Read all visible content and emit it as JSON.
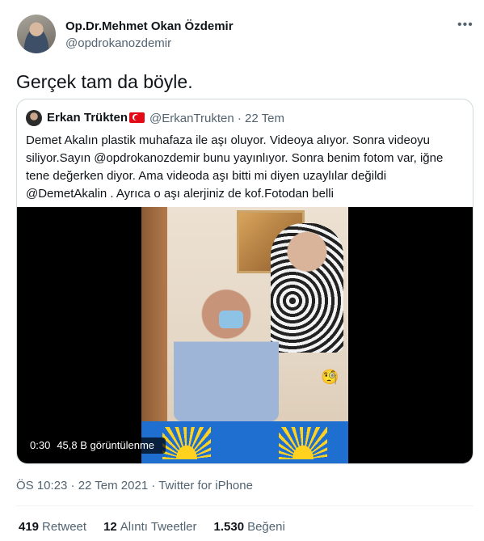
{
  "author": {
    "name": "Op.Dr.Mehmet Okan Özdemir",
    "handle": "@opdrokanozdemir"
  },
  "more_icon": "more-horizontal-icon",
  "tweet_text": "Gerçek tam da böyle.",
  "quote": {
    "author_name": "Erkan Trükten",
    "flag_icon": "turkey-flag-icon",
    "meta": "@ErkanTrukten · 22 Tem",
    "text": "Demet Akalın plastik muhafaza ile aşı oluyor. Videoya alıyor. Sonra videoyu siliyor.Sayın @opdrokanozdemir bunu yayınlıyor. Sonra benim fotom var, iğne tene değerken diyor. Ama videoda aşı bitti mi diyen uzaylılar değildi @DemetAkalin . Ayrıca o aşı alerjiniz de kof.Fotodan belli",
    "video": {
      "duration": "0:30",
      "views": "45,8 B görüntülenme"
    }
  },
  "timestamp": "ÖS 10:23 · 22 Tem 2021 · Twitter for iPhone",
  "stats": {
    "retweet_count": "419",
    "retweet_label": "Retweet",
    "quote_count": "12",
    "quote_label": "Alıntı Tweetler",
    "like_count": "1.530",
    "like_label": "Beğeni"
  }
}
